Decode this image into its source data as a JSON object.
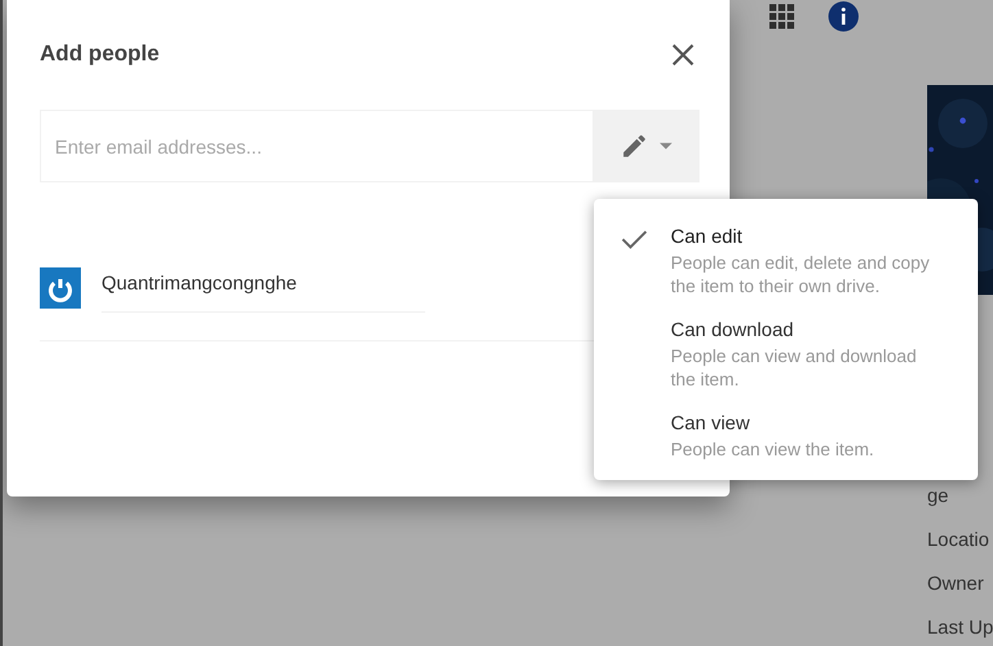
{
  "background": {
    "side_labels": [
      "ge",
      "Locatio",
      "Owner",
      "Last Up"
    ]
  },
  "dialog": {
    "title": "Add people",
    "email_field": {
      "placeholder": "Enter email addresses..."
    },
    "people": [
      {
        "name": "Quantrimangcongnghe"
      }
    ]
  },
  "permission_menu": [
    {
      "label": "Can edit",
      "description": "People can edit, delete and copy the item to their own drive.",
      "selected": true
    },
    {
      "label": "Can download",
      "description": "People can view and download the item.",
      "selected": false
    },
    {
      "label": "Can view",
      "description": "People can view the item.",
      "selected": false
    }
  ]
}
